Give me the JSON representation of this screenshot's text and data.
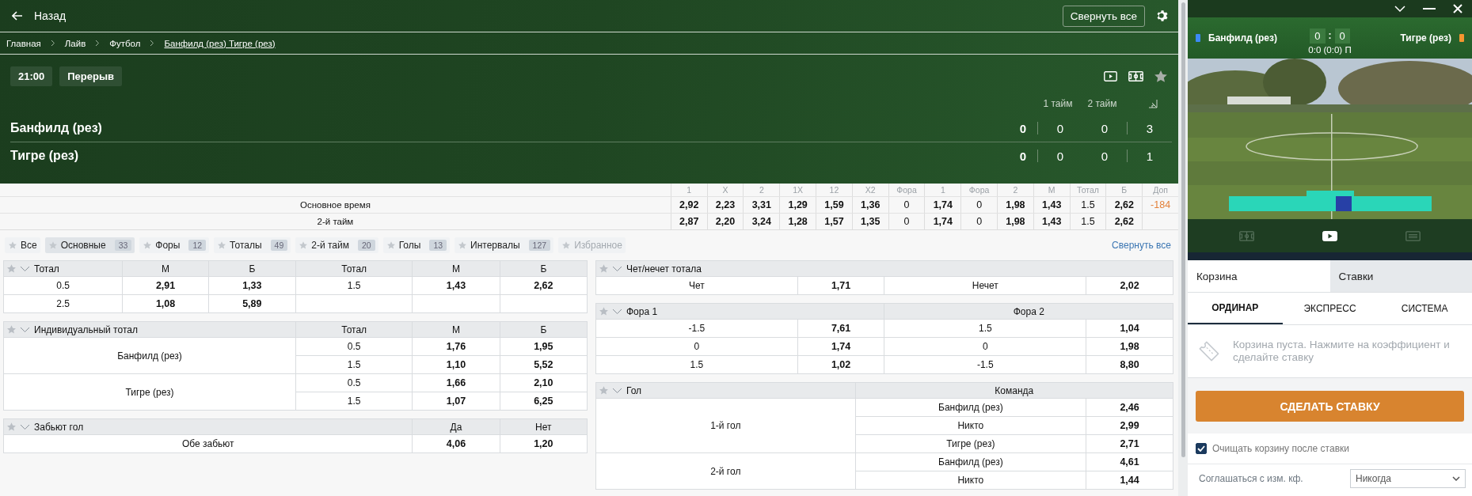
{
  "header": {
    "back_label": "Назад",
    "collapse_button": "Свернуть все"
  },
  "breadcrumbs": [
    {
      "label": "Главная",
      "current": false
    },
    {
      "label": "Лайв",
      "current": false
    },
    {
      "label": "Футбол",
      "current": false
    },
    {
      "label": "Банфилд (рез) Тигре (рез)",
      "current": true
    }
  ],
  "match": {
    "time": "21:00",
    "status": "Перерыв",
    "period_headers": [
      "1 тайм",
      "2 тайм"
    ],
    "teams": [
      {
        "name": "Банфилд (рез)",
        "score": "0",
        "periods": [
          "0",
          "0"
        ],
        "corners": "3"
      },
      {
        "name": "Тигре (рез)",
        "score": "0",
        "periods": [
          "0",
          "0"
        ],
        "corners": "1"
      }
    ]
  },
  "odds_strip": {
    "columns": [
      {
        "label": "1",
        "kind": "odd"
      },
      {
        "label": "X",
        "kind": "odd"
      },
      {
        "label": "2",
        "kind": "odd"
      },
      {
        "label": "1X",
        "kind": "odd"
      },
      {
        "label": "12",
        "kind": "odd"
      },
      {
        "label": "X2",
        "kind": "odd"
      },
      {
        "label": "Фора",
        "kind": "param"
      },
      {
        "label": "1",
        "kind": "odd"
      },
      {
        "label": "Фора",
        "kind": "param"
      },
      {
        "label": "2",
        "kind": "odd"
      },
      {
        "label": "М",
        "kind": "odd"
      },
      {
        "label": "Тотал",
        "kind": "param"
      },
      {
        "label": "Б",
        "kind": "odd"
      },
      {
        "label": "Доп",
        "kind": "extra"
      }
    ],
    "rows": [
      {
        "label": "Основное время",
        "values": [
          "2,92",
          "2,23",
          "3,31",
          "1,29",
          "1,59",
          "1,36",
          "0",
          "1,74",
          "0",
          "1,98",
          "1,43",
          "1.5",
          "2,62",
          "-184"
        ]
      },
      {
        "label": "2-й тайм",
        "values": [
          "2,87",
          "2,20",
          "3,24",
          "1,28",
          "1,57",
          "1,35",
          "0",
          "1,74",
          "0",
          "1,98",
          "1,43",
          "1.5",
          "2,62"
        ]
      }
    ]
  },
  "filters": [
    {
      "label": "Все",
      "selected": false,
      "disabled": false
    },
    {
      "label": "Основные",
      "count": "33",
      "selected": true,
      "disabled": false
    },
    {
      "label": "Форы",
      "count": "12",
      "selected": false,
      "disabled": false
    },
    {
      "label": "Тоталы",
      "count": "49",
      "selected": false,
      "disabled": false
    },
    {
      "label": "2-й тайм",
      "count": "20",
      "selected": false,
      "disabled": false
    },
    {
      "label": "Голы",
      "count": "13",
      "selected": false,
      "disabled": false
    },
    {
      "label": "Интервалы",
      "count": "127",
      "selected": false,
      "disabled": false
    },
    {
      "label": "Избранное",
      "selected": false,
      "disabled": true
    }
  ],
  "collapse_link": "Свернуть все",
  "left_tables": [
    {
      "title": "Тотал",
      "kind": "double_totals",
      "header": [
        "М",
        "Б",
        "Тотал",
        "М",
        "Б"
      ],
      "groups": [
        {
          "rows": [
            [
              "0.5",
              "2,91",
              "1,33",
              "1.5",
              "1,43",
              "2,62"
            ]
          ]
        },
        {
          "rows": [
            [
              "2.5",
              "1,08",
              "5,89"
            ]
          ]
        }
      ]
    },
    {
      "title": "Индивидуальный тотал",
      "kind": "team_totals",
      "header": [
        "Тотал",
        "М",
        "Б"
      ],
      "groups": [
        {
          "label": "Банфилд (рез)",
          "rows": [
            [
              "0.5",
              "1,76",
              "1,95"
            ],
            [
              "1.5",
              "1,10",
              "5,52"
            ]
          ]
        },
        {
          "label": "Тигре (рез)",
          "rows": [
            [
              "0.5",
              "1,66",
              "2,10"
            ],
            [
              "1.5",
              "1,07",
              "6,25"
            ]
          ]
        }
      ]
    },
    {
      "title": "Забьют гол",
      "kind": "yes_no",
      "header": [
        "Да",
        "Нет"
      ],
      "groups": [
        {
          "label": "Обе забьют",
          "rows": [
            [
              "4,06",
              "1,20"
            ]
          ]
        }
      ]
    }
  ],
  "right_tables": [
    {
      "title": "Чет/нечет тотала",
      "kind": "odd_even",
      "groups": [
        {
          "rows": [
            [
              "Чет",
              "1,71",
              "Нечет",
              "2,02"
            ]
          ]
        }
      ]
    },
    {
      "title": "Фора 1",
      "kind": "handicap",
      "header": [
        "Фора 2"
      ],
      "groups": [
        {
          "rows": [
            [
              "-1.5",
              "7,61",
              "1.5",
              "1,04"
            ]
          ]
        },
        {
          "rows": [
            [
              "0",
              "1,74",
              "0",
              "1,98"
            ]
          ]
        },
        {
          "rows": [
            [
              "1.5",
              "1,02",
              "-1.5",
              "8,80"
            ]
          ]
        }
      ]
    },
    {
      "title": "Гол",
      "kind": "goal",
      "header": [
        "Команда"
      ],
      "groups": [
        {
          "label": "1-й гол",
          "rows": [
            [
              "Банфилд (рез)",
              "2,46"
            ],
            [
              "Никто",
              "2,99"
            ],
            [
              "Тигре (рез)",
              "2,71"
            ]
          ]
        },
        {
          "label": "2-й гол",
          "rows": [
            [
              "Банфилд (рез)",
              "4,61"
            ],
            [
              "Никто",
              "1,44"
            ]
          ]
        }
      ]
    }
  ],
  "side_panel": {
    "teams": [
      {
        "name": "Банфилд (рез)",
        "color": "#3d8af7"
      },
      {
        "name": "Тигре (рез)",
        "color": "#f5962f"
      }
    ],
    "score": [
      "0",
      "0"
    ],
    "score_separator": ":",
    "score_detail": "0:0 (0:0) П",
    "video_tabs": [
      {
        "kind": "field",
        "selected": false
      },
      {
        "kind": "video",
        "selected": true
      },
      {
        "kind": "list",
        "selected": false
      }
    ],
    "slip_tabs": [
      {
        "label": "Корзина",
        "selected": true
      },
      {
        "label": "Ставки",
        "selected": false
      }
    ],
    "bet_types": [
      {
        "label": "ОРДИНАР",
        "selected": true
      },
      {
        "label": "ЭКСПРЕСС",
        "selected": false
      },
      {
        "label": "СИСТЕМА",
        "selected": false
      }
    ],
    "empty_message": "Корзина пуста. Нажмите на коэффициент и сделайте ставку",
    "place_bet": "СДЕЛАТЬ СТАВКУ",
    "clear_after": {
      "label": "Очищать корзину после ставки",
      "checked": true
    },
    "accept_changes": {
      "label": "Соглашаться с изм. кф.",
      "value": "Никогда"
    }
  }
}
